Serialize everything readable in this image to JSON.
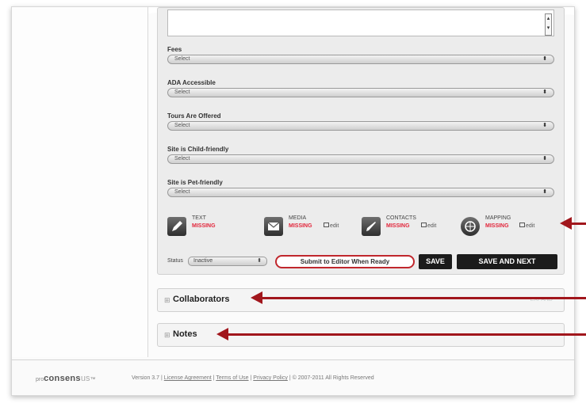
{
  "form": {
    "fields": [
      {
        "label": "Fees",
        "value": "Select"
      },
      {
        "label": "ADA Accessible",
        "value": "Select"
      },
      {
        "label": "Tours Are Offered",
        "value": "Select"
      },
      {
        "label": "Site is Child-friendly",
        "value": "Select"
      },
      {
        "label": "Site is Pet-friendly",
        "value": "Select"
      }
    ],
    "select_arrows": "⬍"
  },
  "status_items": [
    {
      "name": "TEXT",
      "state": "MISSING",
      "icon": "pencil-icon"
    },
    {
      "name": "MEDIA",
      "state": "MISSING",
      "icon": "envelope-icon",
      "edit": "edit"
    },
    {
      "name": "CONTACTS",
      "state": "MISSING",
      "icon": "pen-icon",
      "edit": "edit"
    },
    {
      "name": "MAPPING",
      "state": "MISSING",
      "icon": "globe-icon",
      "edit": "edit"
    }
  ],
  "actions": {
    "status_label": "Status",
    "status_value": "Inactive",
    "submit_label": "Submit to Editor When Ready",
    "save_label": "SAVE",
    "save_next_label": "SAVE AND NEXT"
  },
  "panels": {
    "collaborators": {
      "title": "Collaborators",
      "toggle": "⊞",
      "right_text": "EXPAND"
    },
    "notes": {
      "title": "Notes",
      "toggle": "⊞"
    }
  },
  "footer": {
    "brand_prefix": "pro",
    "brand_main": "consens",
    "brand_suffix": "us",
    "brand_tm": "™",
    "version": "Version 3.7",
    "license": "License Agreement",
    "terms": "Terms of Use",
    "privacy": "Privacy Policy",
    "copyright": "© 2007-2011 All Rights Reserved",
    "separator": "|"
  },
  "colors": {
    "missing": "#e2273c",
    "arrow": "#a1161c",
    "button_dark": "#1b1b1b"
  }
}
